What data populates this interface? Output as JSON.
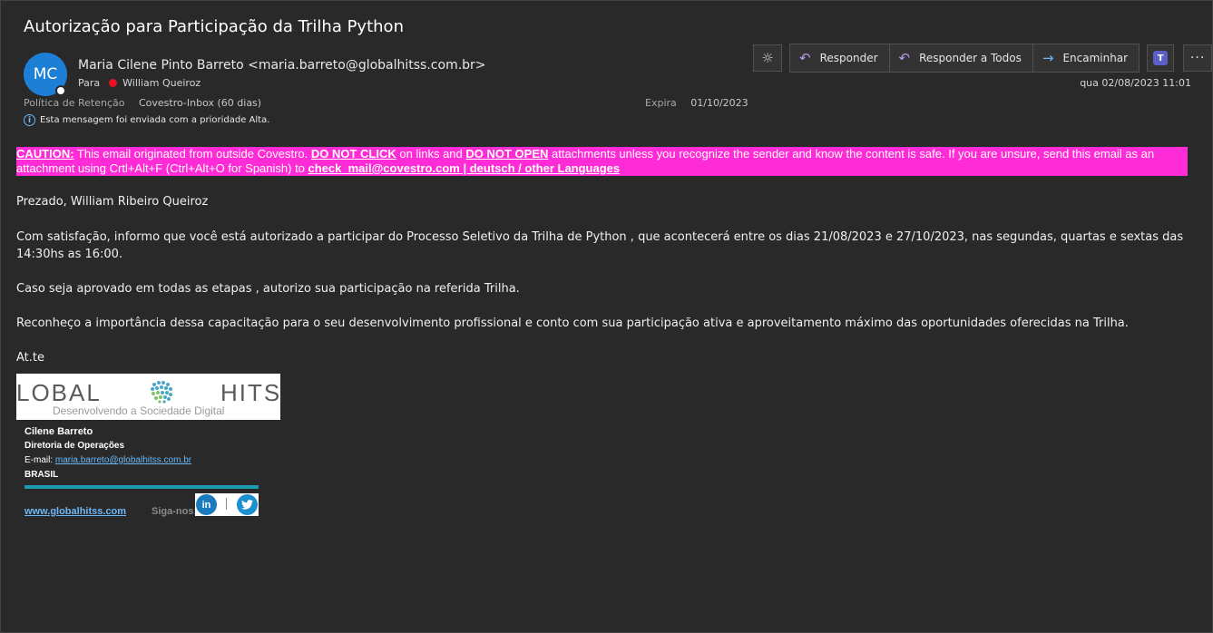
{
  "email": {
    "subject": "Autorização para Participação da Trilha Python",
    "avatar_initials": "MC",
    "sender": "Maria Cilene Pinto Barreto <maria.barreto@globalhitss.com.br>",
    "to_label": "Para",
    "to_name": "William Queiroz",
    "retention_label": "Política de Retenção",
    "retention_value": "Covestro-Inbox (60 dias)",
    "expires_label": "Expira",
    "expires_value": "01/10/2023",
    "priority_note": "Esta mensagem foi enviada com a prioridade Alta.",
    "date_time": "qua 02/08/2023 11:01"
  },
  "toolbar": {
    "reply": "Responder",
    "reply_all": "Responder a Todos",
    "forward": "Encaminhar",
    "more": "···"
  },
  "caution": {
    "caution": "CAUTION:",
    "t1": " This email originated from outside Covestro. ",
    "dnc": "DO NOT CLICK",
    "t2": " on links and ",
    "dno": "DO NOT OPEN",
    "t3": " attachments unless you recognize the sender and know the content is safe. If you are unsure, send this email as an attachment using Crtl+Alt+F (Ctrl+Alt+O for Spanish) to ",
    "mail": "check_mail@covestro.com",
    "sep": " | ",
    "langs": "deutsch / other Languages"
  },
  "body": {
    "greeting": "Prezado, William Ribeiro Queiroz",
    "p1": "Com satisfação, informo que você está autorizado  a participar do Processo Seletivo  da Trilha de Python , que acontecerá entre os dias  21/08/2023  e 27/10/2023, nas segundas, quartas e sextas das 14:30hs as 16:00.",
    "p2": "Caso seja aprovado em todas as etapas , autorizo sua participação na referida Trilha.",
    "p3": "Reconheço a importância dessa capacitação para o seu desenvolvimento profissional e conto com sua participação ativa e aproveitamento máximo das oportunidades oferecidas na Trilha.",
    "closing": "At.te"
  },
  "signature": {
    "logo_left": "LOBAL",
    "logo_right": "HITSS",
    "logo_tagline": "Desenvolvendo a Sociedade Digital",
    "name": "Cilene Barreto",
    "role": "Diretoria de Operações",
    "email_label": "E-mail: ",
    "email": "maria.barreto@globalhitss.com.br",
    "country": "BRASIL",
    "website": "www.globalhitss.com",
    "follow": "Siga-nos:",
    "linkedin": "in"
  },
  "colors": {
    "background": "#292929",
    "caution_bg": "#ff2bd6",
    "avatar": "#1e7fd6",
    "link": "#6cb8f6",
    "accent_line": "#1a9bb0"
  }
}
